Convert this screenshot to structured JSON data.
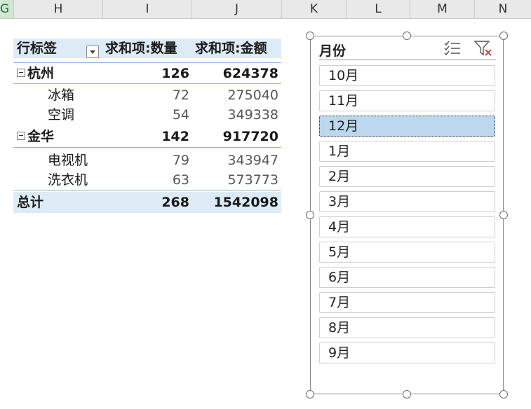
{
  "columns": [
    "G",
    "H",
    "I",
    "J",
    "K",
    "L",
    "M",
    "N"
  ],
  "pivot": {
    "header": {
      "row_label": "行标签",
      "qty": "求和项:数量",
      "amount": "求和项:金额"
    },
    "rows": [
      {
        "label": "杭州",
        "qty": "126",
        "amount": "624378"
      },
      {
        "label": "冰箱",
        "qty": "72",
        "amount": "275040"
      },
      {
        "label": "空调",
        "qty": "54",
        "amount": "349338"
      },
      {
        "label": "金华",
        "qty": "142",
        "amount": "917720"
      },
      {
        "label": "电视机",
        "qty": "79",
        "amount": "343947"
      },
      {
        "label": "洗衣机",
        "qty": "63",
        "amount": "573773"
      }
    ],
    "total": {
      "label": "总计",
      "qty": "268",
      "amount": "1542098"
    }
  },
  "slicer": {
    "title": "月份",
    "selected": "12月",
    "items": [
      "10月",
      "11月",
      "12月",
      "1月",
      "2月",
      "3月",
      "4月",
      "5月",
      "6月",
      "7月",
      "8月",
      "9月"
    ]
  }
}
